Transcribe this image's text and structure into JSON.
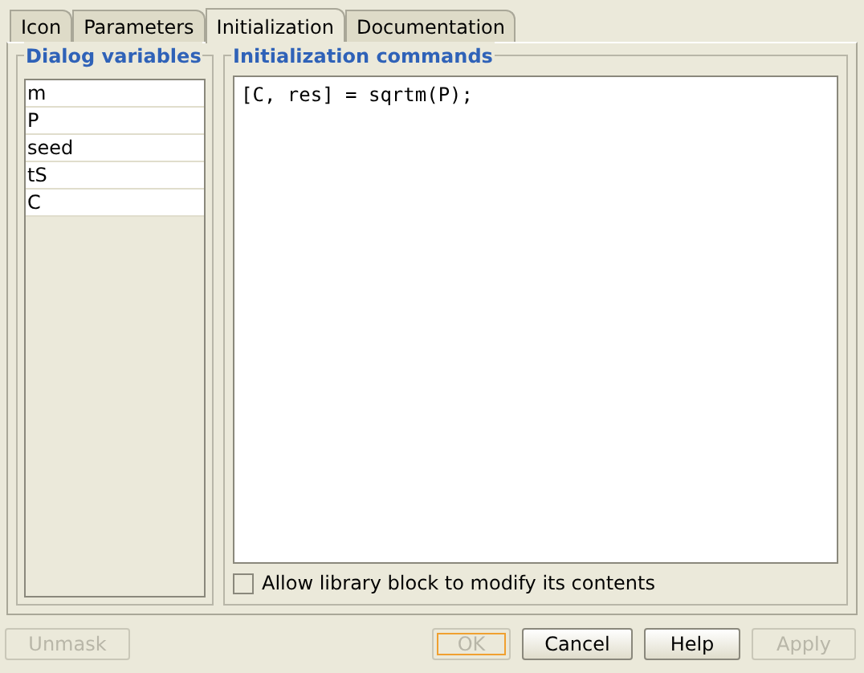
{
  "tabs": [
    {
      "label": "Icon",
      "selected": false
    },
    {
      "label": "Parameters",
      "selected": false
    },
    {
      "label": "Initialization",
      "selected": true
    },
    {
      "label": "Documentation",
      "selected": false
    }
  ],
  "dialog_variables": {
    "title": "Dialog variables",
    "items": [
      "m",
      "P",
      "seed",
      "tS",
      "C"
    ]
  },
  "initialization_commands": {
    "title": "Initialization commands",
    "value": "[C, res] = sqrtm(P);"
  },
  "allow_modify": {
    "label": "Allow library block to modify its contents",
    "checked": false
  },
  "buttons": [
    {
      "label": "Unmask",
      "disabled": true,
      "focused": false
    },
    {
      "label": "OK",
      "disabled": true,
      "focused": true
    },
    {
      "label": "Cancel",
      "disabled": false,
      "focused": false
    },
    {
      "label": "Help",
      "disabled": false,
      "focused": false
    },
    {
      "label": "Apply",
      "disabled": true,
      "focused": false
    }
  ]
}
